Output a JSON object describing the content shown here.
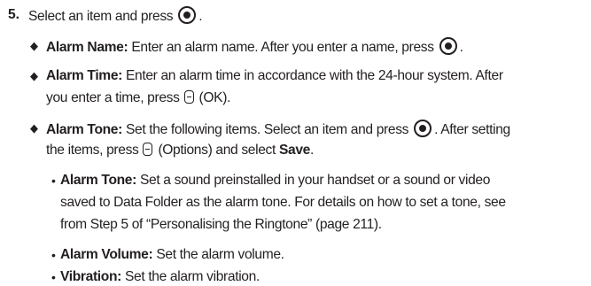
{
  "step": {
    "number": "5.",
    "text": "Select an item and press"
  },
  "items": [
    {
      "label": "Alarm Name:",
      "line1": "Enter an alarm name. After you enter a name, press"
    },
    {
      "label": "Alarm Time:",
      "line1": "Enter an alarm time in accordance with the 24-hour system. After",
      "line2_pre": "you enter a time, press",
      "line2_post": "(OK)."
    },
    {
      "label": "Alarm Tone:",
      "line1": "Set the following items. Select an item and press",
      "line1_post": ". After setting",
      "line2_pre": "the items, press",
      "line2_mid": "(Options) and select",
      "line2_bold": "Save",
      "line2_end": "."
    }
  ],
  "subitems": [
    {
      "label": "Alarm Tone:",
      "lines": [
        "Set a sound preinstalled in your handset or a sound or video",
        "saved to Data Folder as the alarm tone. For details on how to set a tone, see",
        "from Step 5 of “Personalising the Ringtone” (page 211)."
      ]
    },
    {
      "label": "Alarm Volume:",
      "text": "Set the alarm volume."
    },
    {
      "label": "Vibration:",
      "text": "Set the alarm vibration."
    }
  ],
  "symbols": {
    "diamond": "◆",
    "bullet": "•",
    "center_key_icon": "center-select-key-icon",
    "soft_key_icon": "soft-key-icon"
  }
}
